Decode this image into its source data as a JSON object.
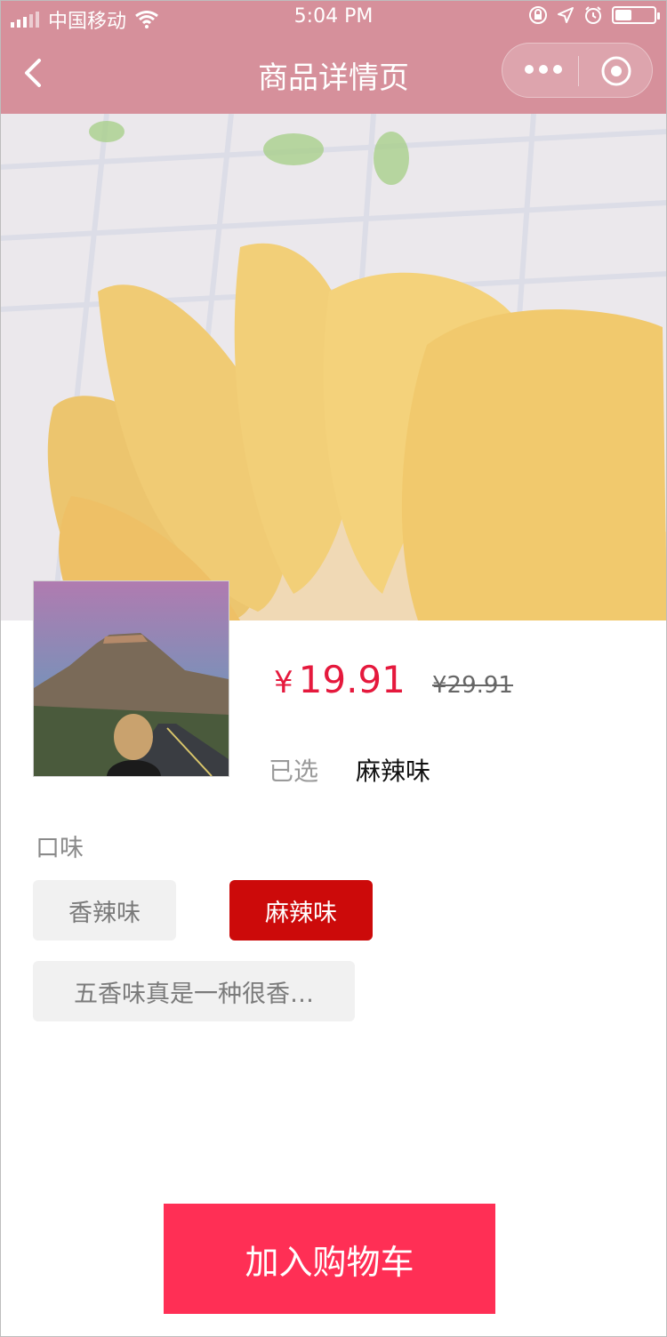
{
  "status_bar": {
    "carrier": "中国移动",
    "time": "5:04 PM"
  },
  "navbar": {
    "title": "商品详情页"
  },
  "product": {
    "price_symbol": "¥",
    "price": "19.91",
    "original_price": "¥29.91",
    "selected_label": "已选",
    "selected_value": "麻辣味"
  },
  "flavor_section": {
    "title": "口味",
    "options": [
      {
        "label": "香辣味",
        "active": false
      },
      {
        "label": "麻辣味",
        "active": true
      },
      {
        "label": "五香味真是一种很香…",
        "active": false
      }
    ]
  },
  "actions": {
    "add_to_cart": "加入购物车"
  },
  "colors": {
    "nav_overlay": "#d6909b",
    "price_red": "#e5193d",
    "active_option": "#cc0a0a",
    "cart_button": "#ff2f55"
  },
  "icons": [
    "signal-icon",
    "wifi-icon",
    "rotation-lock-icon",
    "location-icon",
    "alarm-icon",
    "battery-icon",
    "back-arrow-icon",
    "more-dots-icon",
    "target-icon"
  ]
}
